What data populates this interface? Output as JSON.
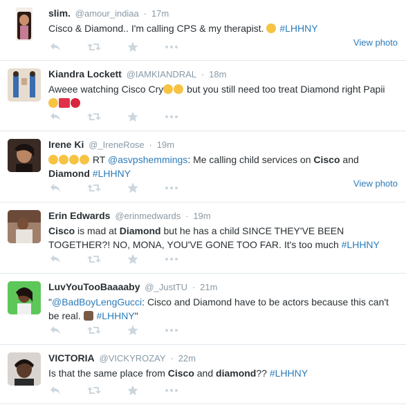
{
  "colors": {
    "link": "#2b7bb9",
    "meta": "#8899a6",
    "text": "#292f33",
    "icon": "#ccd6dd",
    "divider": "#e1e8ed"
  },
  "icons": {
    "reply": "reply-icon",
    "retweet": "retweet-icon",
    "favorite": "star-icon",
    "more": "more-icon"
  },
  "view_photo_label": "View photo",
  "tweets": [
    {
      "name": "slim.",
      "handle": "@amour_indiaa",
      "time": "17m",
      "text1": "Cisco & Diamond.. I'm calling CPS & my therapist. ",
      "tag": "#LHHNY",
      "emoji": "crying-face"
    },
    {
      "name": "Kiandra Lockett",
      "handle": "@IAMKIANDRAL",
      "time": "18m",
      "text1": "Aweee watching Cisco Cry",
      "text2": " but you still need too treat Diamond right Papii",
      "emoji": "weary-face, kiss, hundred, heart"
    },
    {
      "name": "Irene Ki",
      "handle": "@_IreneRose",
      "time": "19m",
      "rt": " RT ",
      "mention": "@asvpshemmings",
      "text1": ": Me calling child services on ",
      "b1": "Cisco",
      "and": " and",
      "b2": "Diamond",
      "tag": "#LHHNY"
    },
    {
      "name": "Erin Edwards",
      "handle": "@erinmedwards",
      "time": "19m",
      "b1": "Cisco",
      "text1": " is mad at ",
      "b2": "Diamond",
      "text2": " but he has a child SINCE THEY'VE BEEN",
      "text3": "TOGETHER?! NO, MONA, YOU'VE GONE TOO FAR. It's too much ",
      "tag": "#LHHNY"
    },
    {
      "name": "LuvYouTooBaaaaby",
      "handle": "@_JustTU",
      "time": "21m",
      "quote_open": "\"",
      "mention": "@BadBoyLengGucci",
      "text1": ": Cisco and Diamond have to be actors because this can't",
      "text2": "be real. ",
      "tag": "#LHHNY",
      "quote_close": "\""
    },
    {
      "name": "VICTORIA",
      "handle": "@VICKYROZAY",
      "time": "22m",
      "text1": "Is that the same place from ",
      "b1": "Cisco",
      "and": " and ",
      "b2": "diamond",
      "text2": "?? ",
      "tag": "#LHHNY"
    }
  ]
}
